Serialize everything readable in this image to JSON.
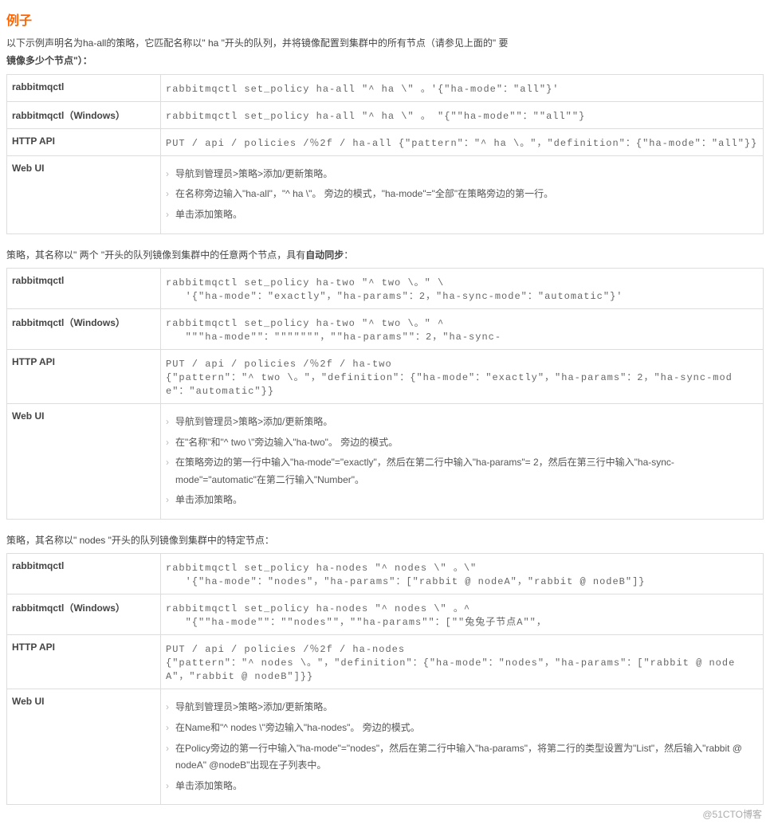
{
  "title": "例子",
  "intro_line1": "以下示例声明名为ha-all的策略，它匹配名称以\" ha \"开头的队列，并将镜像配置到集群中的所有节点（请参见上面的\" 要",
  "intro_line2": "镜像多少个节点\"）：",
  "labels": {
    "rabbitmqctl": "rabbitmqctl",
    "rabbitmqctl_win": "rabbitmqctl（Windows）",
    "http_api": "HTTP API",
    "web_ui": "Web UI"
  },
  "ex1": {
    "r_ctl": "rabbitmqctl set_policy ha-all \"^ ha \\\" 。'{\"ha-mode\"：\"all\"}'",
    "r_ctl_win": "rabbitmqctl set_policy ha-all \"^ ha \\\" 。 \"{\"\"ha-mode\"\"：\"\"all\"\"}",
    "http": "PUT / api / policies /％2f / ha-all {\"pattern\"：\"^ ha \\。\"，\"definition\"：{\"ha-mode\"：\"all\"}}",
    "web_ui": [
      "导航到管理员>策略>添加/更新策略。",
      "在名称旁边输入\"ha-all\"，\"^ ha \\\"。 旁边的模式，\"ha-mode\"=\"全部\"在策略旁边的第一行。",
      "单击添加策略。"
    ]
  },
  "ex2_intro_a": "策略，其名称以\" 两个 \"开头的队列镜像到集群中的任意两个节点，具有",
  "ex2_intro_b": "自动同步",
  "ex2_intro_c": "：",
  "ex2": {
    "r_ctl": "rabbitmqctl set_policy ha-two \"^ two \\。\" \\\n   '{\"ha-mode\"：\"exactly\"，\"ha-params\"：2，\"ha-sync-mode\"：\"automatic\"}'",
    "r_ctl_win": "rabbitmqctl set_policy ha-two \"^ two \\。\" ^\n   \"\"\"ha-mode\"\"：\"\"\"\"\"\"\"，\"\"ha-params\"\"：2，\"ha-sync-",
    "http": "PUT / api / policies /％2f / ha-two\n{\"pattern\"：\"^ two \\。\"，\"definition\"：{\"ha-mode\"：\"exactly\"，\"ha-params\"：2，\"ha-sync-mode\"：\"automatic\"}}",
    "web_ui": [
      "导航到管理员>策略>添加/更新策略。",
      "在\"名称\"和\"^ two \\\"旁边输入\"ha-two\"。 旁边的模式。",
      "在策略旁边的第一行中输入\"ha-mode\"=\"exactly\"，然后在第二行中输入\"ha-params\"= 2，然后在第三行中输入\"ha-sync-mode\"=\"automatic\"在第二行输入\"Number\"。",
      "单击添加策略。"
    ]
  },
  "ex3_intro": "策略，其名称以\" nodes \"开头的队列镜像到集群中的特定节点：",
  "ex3": {
    "r_ctl": "rabbitmqctl set_policy ha-nodes \"^ nodes \\\" 。\\\"\n   '{\"ha-mode\"：\"nodes\"，\"ha-params\"：[\"rabbit @ nodeA\"，\"rabbit @ nodeB\"]}",
    "r_ctl_win": "rabbitmqctl set_policy ha-nodes \"^ nodes \\\" 。^\n   \"{\"\"ha-mode\"\"：\"\"nodes\"\"，\"\"ha-params\"\"：[\"\"兔兔子节点A\"\"，",
    "http": "PUT / api / policies /％2f / ha-nodes\n{\"pattern\"：\"^ nodes \\。\"，\"definition\"：{\"ha-mode\"：\"nodes\"，\"ha-params\"：[\"rabbit @ nodeA\"，\"rabbit @ nodeB\"]}}",
    "web_ui": [
      "导航到管理员>策略>添加/更新策略。",
      "在Name和\"^ nodes \\\"旁边输入\"ha-nodes\"。 旁边的模式。",
      "在Policy旁边的第一行中输入\"ha-mode\"=\"nodes\"，然后在第二行中输入\"ha-params\"，将第二行的类型设置为\"List\"，然后输入\"rabbit @ nodeA\" @nodeB\"出现在子列表中。",
      "单击添加策略。"
    ]
  },
  "watermark": "@51CTO博客"
}
